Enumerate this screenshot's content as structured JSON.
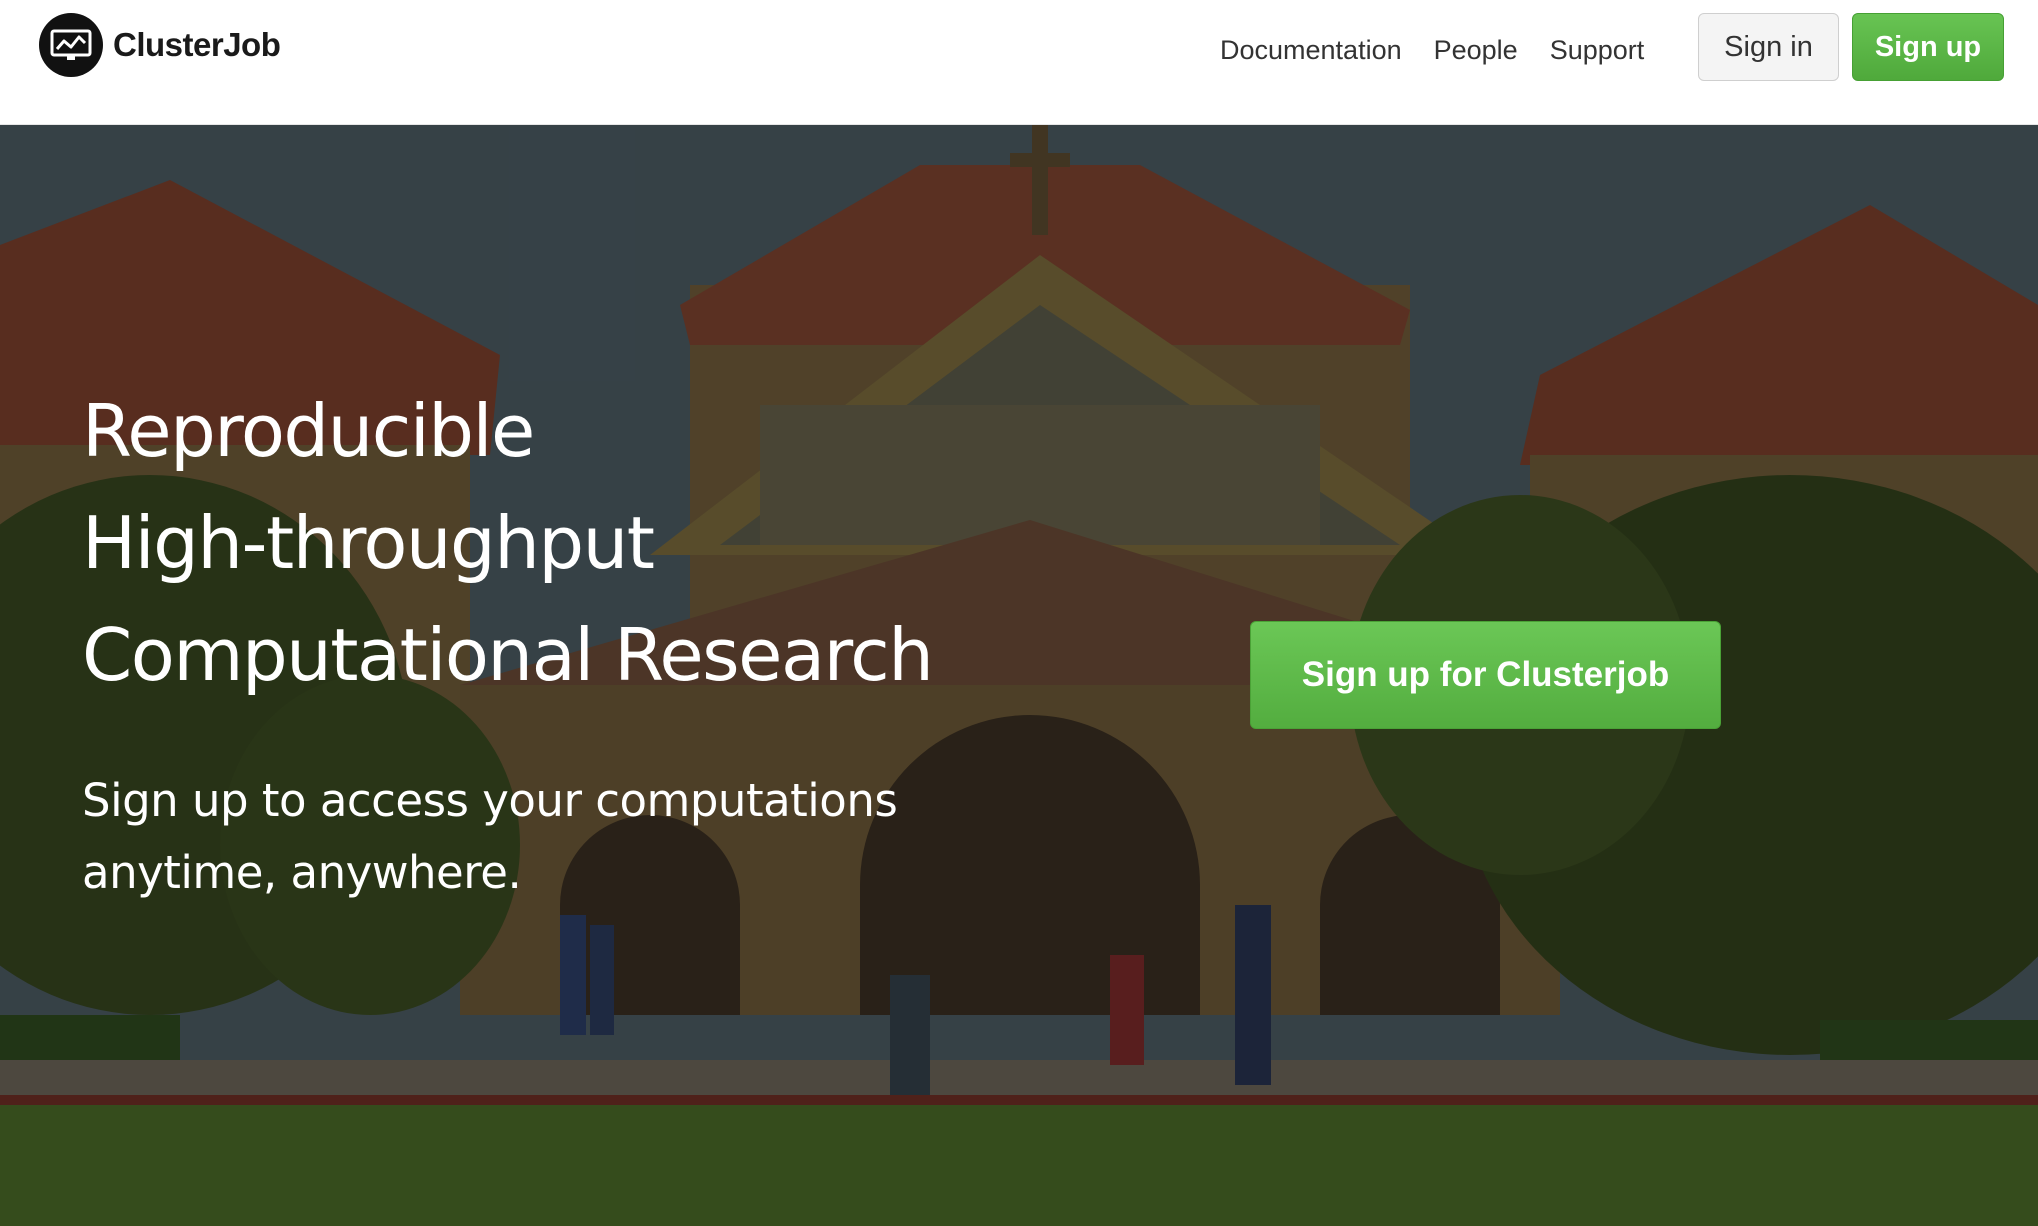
{
  "brand": {
    "name": "ClusterJob",
    "logo_icon": "monitor-chart-logo-icon"
  },
  "nav": {
    "links": [
      {
        "label": "Documentation"
      },
      {
        "label": "People"
      },
      {
        "label": "Support"
      }
    ],
    "signin_label": "Sign in",
    "signup_label": "Sign up"
  },
  "hero": {
    "title_lines": [
      "Reproducible",
      "High-throughput",
      "Computational Research"
    ],
    "subtitle_lines": [
      "Sign up to access your computations",
      "anytime, anywhere."
    ],
    "cta_label": "Sign up for Clusterjob",
    "background": "photo-of-campus-church-courtyard"
  },
  "colors": {
    "accent_green": "#5cb85c",
    "text_dark": "#333333",
    "hero_text": "#ffffff"
  }
}
